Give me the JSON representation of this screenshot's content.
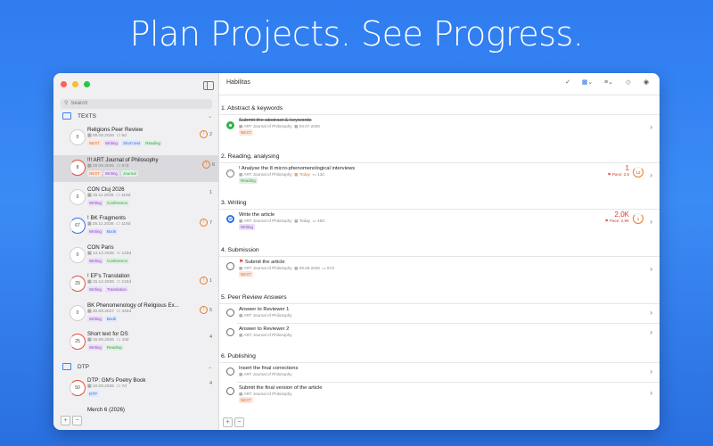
{
  "headline": "Plan Projects. See Progress.",
  "colors": {
    "accent": "#2e6ee8",
    "done": "#35b34a",
    "alert": "#e0352b",
    "warning": "#e67e22",
    "background": "#2f7cf0"
  },
  "sidebar": {
    "search_placeholder": "Search",
    "groups": [
      {
        "name": "TEXTS"
      },
      {
        "name": "DTP"
      }
    ],
    "items": [
      {
        "progress": "0",
        "title": "Religions Peer Review",
        "date": "09.08.2026",
        "count": "5d",
        "tags": [
          "NEXT",
          "Writing",
          "Short text",
          "Reading"
        ],
        "right_badge": "!",
        "right_count": "2"
      },
      {
        "progress": "8",
        "title": "!!! ART Journal of Philosophy",
        "date": "29.09.2026",
        "count": "97d",
        "tags": [
          "NEXT",
          "Writing",
          "Journal"
        ],
        "right_badge": "!",
        "right_count": "6"
      },
      {
        "progress": "0",
        "title": "CON Cluj 2026",
        "date": "16.11.2026",
        "count": "118d",
        "tags": [
          "Writing",
          "Conference"
        ],
        "right_badge": "",
        "right_count": "1"
      },
      {
        "progress": "67",
        "title": "! BK Fragments",
        "date": "25.11.2026",
        "count": "119d",
        "tags": [
          "Writing",
          "Book"
        ],
        "right_badge": "!",
        "right_count": "7"
      },
      {
        "progress": "0",
        "title": "CON Paris",
        "date": "14.12.2026",
        "count": "133d",
        "tags": [
          "Writing",
          "Conference"
        ],
        "right_badge": "",
        "right_count": ""
      },
      {
        "progress": "29",
        "title": "! EF's Translation",
        "date": "15.12.2026",
        "count": "134d",
        "tags": [
          "Writing",
          "Translation"
        ],
        "right_badge": "!",
        "right_count": "1"
      },
      {
        "progress": "0",
        "title": "BK Phenomenology of Religious Ex...",
        "date": "30.09.2027",
        "count": "425d",
        "tags": [
          "Writing",
          "Book"
        ],
        "right_badge": "!",
        "right_count": "5"
      },
      {
        "progress": "25",
        "title": "Short text for DS",
        "date": "15.08.2026",
        "count": "43d",
        "tags": [
          "Writing",
          "Reading"
        ],
        "right_badge": "",
        "right_count": "4"
      },
      {
        "progress": "50",
        "title": "DTP: GM's Poetry Book",
        "date": "10.08.2026",
        "count": "7d",
        "tags": [
          "DTP"
        ],
        "right_badge": "",
        "right_count": "4"
      },
      {
        "progress": "",
        "title": "Merch 6 (2026)",
        "date": "",
        "count": "",
        "tags": [],
        "right_badge": "",
        "right_count": ""
      }
    ]
  },
  "main": {
    "title": "Habilitas",
    "sections": [
      {
        "name": "1. Abstract & keywords"
      },
      {
        "name": "2. Reading, analysing"
      },
      {
        "name": "3. Writing"
      },
      {
        "name": "4. Submission"
      },
      {
        "name": "5. Peer Review Answers"
      },
      {
        "name": "6. Publishing"
      }
    ],
    "tasks": [
      {
        "title": "Submit the abstract & keywords",
        "project": "ART Journal of Philosophy",
        "date": "03.07.2026",
        "extra": "",
        "tags": [
          "NEXT"
        ]
      },
      {
        "title": "! Analyse the 8 micro-phenomenological interviews",
        "project": "ART Journal of Philosophy",
        "date": "Today",
        "extra": "13d",
        "tags": [
          "Reading"
        ],
        "metric": "1",
        "metric_sub": "Pace: 2,5",
        "ring": "12"
      },
      {
        "title": "Write the article",
        "project": "ART Journal of Philosophy",
        "date": "Today",
        "extra": "48d",
        "tags": [
          "Writing"
        ],
        "metric": "2,0K",
        "metric_sub": "Pace: 2,9K",
        "ring": "1"
      },
      {
        "title": "Submit the article",
        "project": "ART Journal of Philosophy",
        "date": "09.08.2026",
        "extra": "57d",
        "tags": [
          "NEXT"
        ]
      },
      {
        "title": "Answer to Reviewer 1",
        "project": "ART Journal of Philosophy",
        "date": "",
        "extra": "",
        "tags": []
      },
      {
        "title": "Answer to Reviewer 2",
        "project": "ART Journal of Philosophy",
        "date": "",
        "extra": "",
        "tags": []
      },
      {
        "title": "Insert the final corrections",
        "project": "ART Journal of Philosophy",
        "date": "",
        "extra": "",
        "tags": []
      },
      {
        "title": "Submit the final version of the article",
        "project": "ART Journal of Philosophy",
        "date": "",
        "extra": "",
        "tags": [
          "NEXT"
        ]
      }
    ]
  },
  "controls": {
    "add": "+",
    "remove": "−",
    "arrow": "›"
  }
}
